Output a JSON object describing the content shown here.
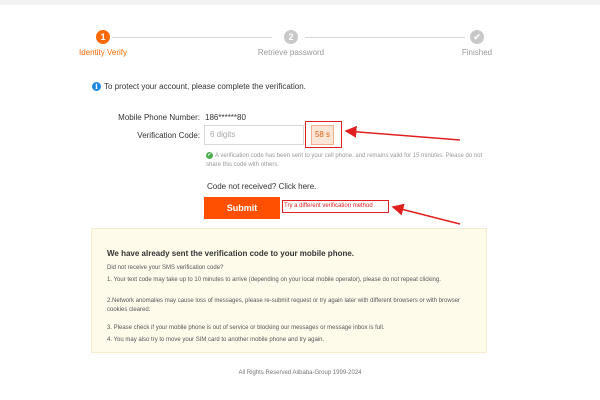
{
  "steps": [
    {
      "number": "1",
      "label": "Identity Verify"
    },
    {
      "number": "2",
      "label": "Retrieve password"
    },
    {
      "number": "✔",
      "label": "Finished"
    }
  ],
  "notice": "To protect your account, please complete the verification.",
  "form": {
    "phone_label": "Mobile Phone Number:",
    "phone_value": "186******80",
    "code_label": "Verification Code:",
    "code_placeholder": "6 digits",
    "countdown": "58 s",
    "sent_message": "A verification code has been sent to your cell phone, and remains valid for 15 minutes. Please do not share this code with others.",
    "not_received": "Code not received? Click here.",
    "submit_label": "Submit",
    "try_different": "Try a different verification method"
  },
  "infobox": {
    "title": "We have already sent the verification code to your mobile phone.",
    "lines": [
      "Did not receive your SMS verification code?",
      "1. Your text code may take up to 10 minutes to arrive (depending on your local mobile operator), please do not repeat clicking.",
      "2.Network anomalies may cause loss of messages, please re-submit request or try again later with different browsers or with browser cookies cleared.",
      "3. Please check if your mobile phone is out of service or blocking our messages or message inbox is full.",
      "4. You may also try to move your SIM card to another mobile phone and try again."
    ]
  },
  "footer": "All Rights Reserved Alibaba-Group 1999-2024",
  "colors": {
    "accent": "#ff6a00",
    "submit": "#ff5000",
    "annotation": "#e02020",
    "info": "#1e88e5",
    "success": "#4caf50"
  }
}
